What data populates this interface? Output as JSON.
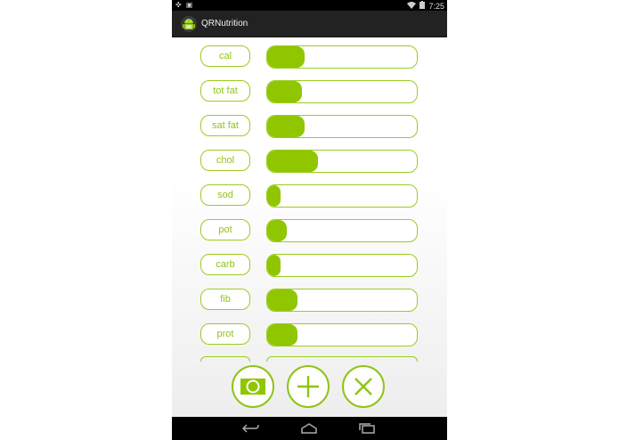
{
  "status_bar": {
    "time": "7:25",
    "icons": [
      "wifi-icon",
      "battery-icon",
      "screenshot-icon"
    ]
  },
  "app": {
    "title": "QRNutrition",
    "icon": "android-app-icon"
  },
  "nutrients": [
    {
      "label": "cal",
      "level": 0.25
    },
    {
      "label": "tot fat",
      "level": 0.23
    },
    {
      "label": "sat fat",
      "level": 0.25
    },
    {
      "label": "chol",
      "level": 0.34
    },
    {
      "label": "sod",
      "level": 0.09
    },
    {
      "label": "pot",
      "level": 0.13
    },
    {
      "label": "carb",
      "level": 0.09
    },
    {
      "label": "fib",
      "level": 0.2
    },
    {
      "label": "prot",
      "level": 0.2
    }
  ],
  "actions": {
    "icons": [
      "camera-icon",
      "plus-icon",
      "close-icon"
    ]
  },
  "navigation": {
    "icons": [
      "back-icon",
      "home-icon",
      "recents-icon"
    ]
  },
  "colors": {
    "accent": "#8fc416",
    "fill": "#8fc600",
    "bar_border": "#9acd1e",
    "action_bar": "#222222"
  }
}
